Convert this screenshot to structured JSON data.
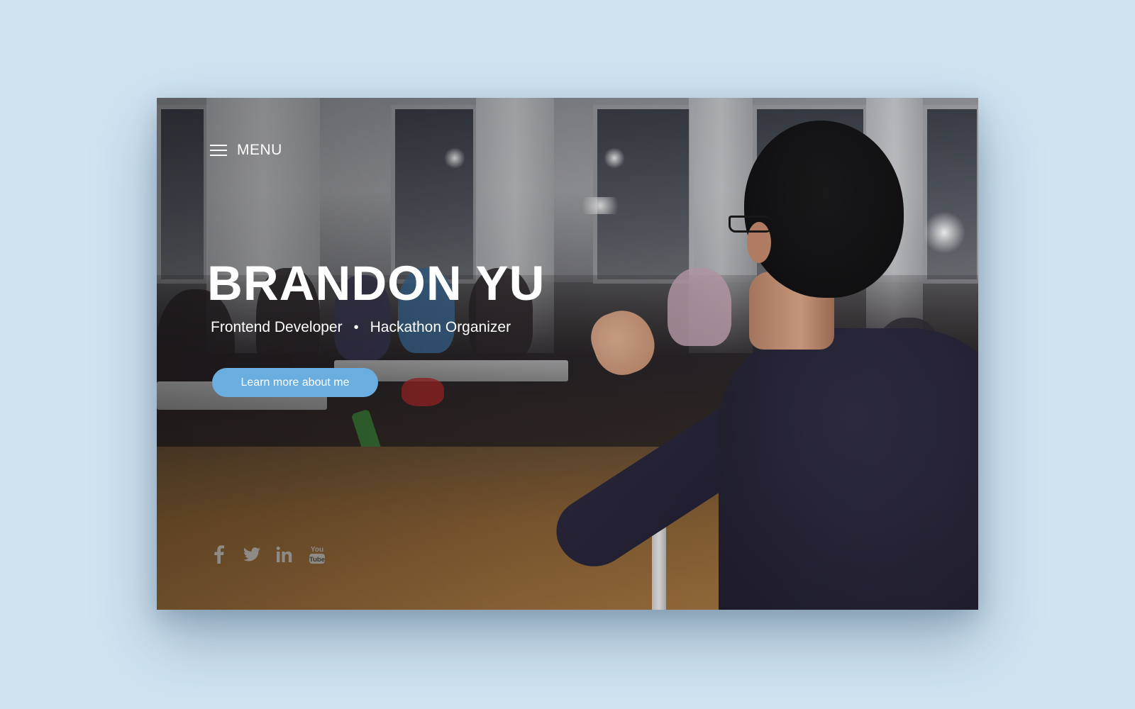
{
  "menu": {
    "label": "MENU",
    "icon": "hamburger-icon"
  },
  "hero": {
    "name": "BRANDON YU",
    "roles": [
      "Frontend Developer",
      "Hackathon Organizer"
    ],
    "separator": "•",
    "cta_label": "Learn more about me"
  },
  "social": [
    {
      "name": "facebook",
      "icon": "facebook-icon",
      "label": "f"
    },
    {
      "name": "twitter",
      "icon": "twitter-icon"
    },
    {
      "name": "linkedin",
      "icon": "linkedin-icon",
      "label": "in"
    },
    {
      "name": "youtube",
      "icon": "youtube-icon",
      "label_top": "You",
      "label_bottom": "Tube"
    }
  ],
  "colors": {
    "page_background": "#cfe3f1",
    "cta_background": "#6aaee0",
    "text": "#ffffff",
    "social_icons": "#8e8a86"
  }
}
